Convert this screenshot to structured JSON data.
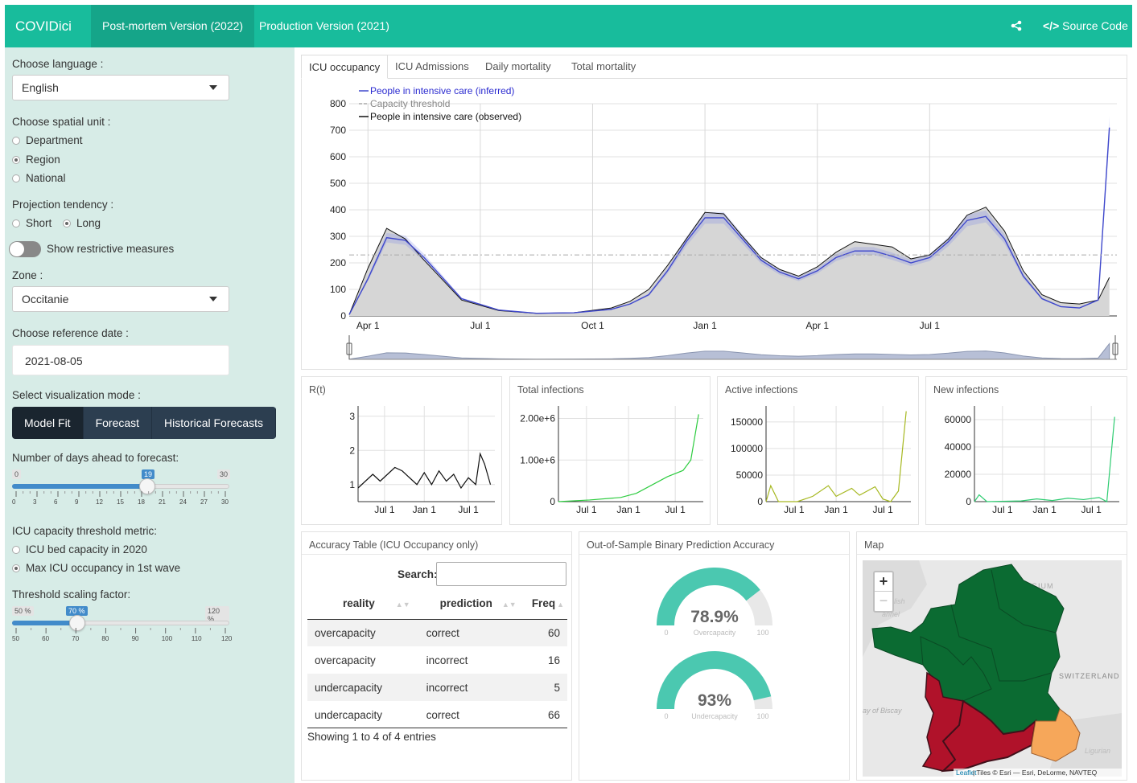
{
  "navbar": {
    "brand": "COVIDici",
    "tabs": [
      "Post-mortem Version (2022)",
      "Production Version (2021)"
    ],
    "source_code": "Source Code"
  },
  "sidebar": {
    "language_label": "Choose language :",
    "language_value": "English",
    "spatial_label": "Choose spatial unit :",
    "spatial_options": [
      "Department",
      "Region",
      "National"
    ],
    "spatial_selected": "Region",
    "projection_label": "Projection tendency :",
    "projection_options": [
      "Short",
      "Long"
    ],
    "projection_selected": "Long",
    "restrictive_label": "Show restrictive measures",
    "zone_label": "Zone :",
    "zone_value": "Occitanie",
    "refdate_label": "Choose reference date :",
    "refdate_value": "2021-08-05",
    "vizmode_label": "Select visualization mode :",
    "vizmode_buttons": [
      "Model Fit",
      "Forecast",
      "Historical Forecasts"
    ],
    "vizmode_active": "Model Fit",
    "days_label": "Number of days ahead to forecast:",
    "days_slider": {
      "min": "0",
      "max": "30",
      "value": "19",
      "ticks": [
        "0",
        "3",
        "6",
        "9",
        "12",
        "15",
        "18",
        "21",
        "24",
        "27",
        "30"
      ]
    },
    "icu_metric_label": "ICU capacity threshold metric:",
    "icu_metric_options": [
      "ICU bed capacity in 2020",
      "Max ICU occupancy in 1st wave"
    ],
    "icu_metric_selected": "Max ICU occupancy in 1st wave",
    "scaling_label": "Threshold scaling factor:",
    "scaling_slider": {
      "min": "50 %",
      "max": "120 %",
      "value": "70 %",
      "ticks": [
        "50",
        "60",
        "70",
        "80",
        "90",
        "100",
        "110",
        "120"
      ]
    }
  },
  "main_tabs": [
    "ICU occupancy",
    "ICU Admissions",
    "Daily mortality",
    "Total mortality"
  ],
  "main_tab_active": "ICU occupancy",
  "mini_charts": [
    {
      "title": "R(t)",
      "yticks": [
        "3",
        "2",
        "1"
      ],
      "xticks": [
        "Jul 1",
        "Jan 1",
        "Jul 1"
      ]
    },
    {
      "title": "Total infections",
      "yticks": [
        "2.00e+6",
        "1.00e+6",
        "0"
      ],
      "xticks": [
        "Jul 1",
        "Jan 1",
        "Jul 1"
      ]
    },
    {
      "title": "Active infections",
      "yticks": [
        "150000",
        "100000",
        "50000",
        "0"
      ],
      "xticks": [
        "Jul 1",
        "Jan 1",
        "Jul 1"
      ]
    },
    {
      "title": "New infections",
      "yticks": [
        "60000",
        "40000",
        "20000",
        "0"
      ],
      "xticks": [
        "Jul 1",
        "Jan 1",
        "Jul 1"
      ]
    }
  ],
  "accuracy": {
    "title": "Accuracy Table (ICU Occupancy only)",
    "search_label": "Search:",
    "columns": [
      "reality",
      "prediction",
      "Freq"
    ],
    "rows": [
      [
        "overcapacity",
        "correct",
        "60"
      ],
      [
        "overcapacity",
        "incorrect",
        "16"
      ],
      [
        "undercapacity",
        "incorrect",
        "5"
      ],
      [
        "undercapacity",
        "correct",
        "66"
      ]
    ],
    "footer": "Showing 1 to 4 of 4 entries"
  },
  "binary": {
    "title": "Out-of-Sample Binary Prediction Accuracy",
    "gauges": [
      {
        "value": "78.9%",
        "label": "Overcapacity",
        "min": "0",
        "max": "100",
        "fraction": 0.789
      },
      {
        "value": "93%",
        "label": "Undercapacity",
        "min": "0",
        "max": "100",
        "fraction": 0.93
      }
    ],
    "color": "#4bc8b0"
  },
  "map": {
    "title": "Map",
    "zoom_in": "+",
    "zoom_out": "−",
    "labels": [
      "BELGIUM",
      "glish",
      "annel",
      "SWITZERLAND",
      "ay of Biscay",
      "Ligurian"
    ],
    "attribution_link": "Leaflet",
    "attribution_text": " | Tiles © Esri — Esri, DeLorme, NAVTEQ"
  },
  "chart_data": {
    "type": "area",
    "legend": [
      "People in intensive care (inferred)",
      "Capacity threshold",
      "People in intensive care (observed)"
    ],
    "x_ticks": [
      "Apr 1",
      "Jul 1",
      "Oct 1",
      "Jan 1",
      "Apr 1",
      "Jul 1"
    ],
    "ylim": [
      0,
      800
    ],
    "y_ticks": [
      0,
      100,
      200,
      300,
      400,
      500,
      600,
      700,
      800
    ],
    "threshold": 230,
    "x_months": [
      0,
      0.5,
      1,
      1.5,
      2,
      3,
      4,
      5,
      6,
      7,
      7.5,
      8,
      8.5,
      9,
      9.5,
      10,
      10.5,
      11,
      11.5,
      12,
      12.5,
      13,
      13.5,
      14,
      14.5,
      15,
      15.5,
      16,
      16.5,
      17,
      17.5,
      18,
      18.5,
      19,
      19.5,
      20,
      20.3
    ],
    "observed": [
      5,
      180,
      330,
      290,
      210,
      60,
      20,
      10,
      12,
      30,
      55,
      100,
      190,
      290,
      390,
      385,
      300,
      220,
      175,
      150,
      185,
      240,
      280,
      270,
      260,
      215,
      230,
      290,
      380,
      410,
      320,
      170,
      80,
      50,
      45,
      60,
      145
    ],
    "inferred": [
      5,
      140,
      295,
      285,
      220,
      65,
      22,
      10,
      12,
      25,
      45,
      80,
      170,
      280,
      370,
      370,
      290,
      210,
      165,
      140,
      170,
      220,
      245,
      245,
      225,
      200,
      220,
      280,
      360,
      375,
      290,
      150,
      65,
      35,
      30,
      60,
      710
    ],
    "series_colors": {
      "inferred": "#3f48cc",
      "threshold": "#aaaaaa",
      "observed": "#111111"
    }
  }
}
